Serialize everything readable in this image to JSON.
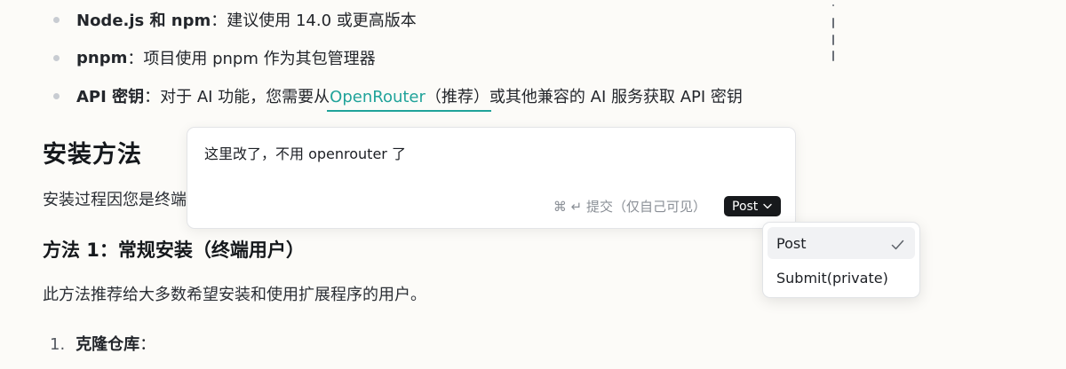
{
  "prerequisites": [
    {
      "term": "Node.js 和 npm",
      "sep": "：",
      "text": "建议使用 14.0 或更高版本"
    },
    {
      "term": "pnpm",
      "sep": "：",
      "text": "项目使用 pnpm 作为其包管理器"
    },
    {
      "term": "API 密钥",
      "sep": "：",
      "text_before": "对于 AI 功能，您需要从 ",
      "link": "OpenRouter",
      "text_after": "（推荐）或其他兼容的 AI 服务获取 API 密钥"
    }
  ],
  "install_section": {
    "title": "安装方法",
    "intro": "安装过程因您是终端"
  },
  "method1": {
    "title": "方法 1：常规安装（终端用户）",
    "description": "此方法推荐给大多数希望安装和使用扩展程序的用户。"
  },
  "steps": [
    {
      "number": "1.",
      "label": "克隆仓库",
      "sep": "："
    }
  ],
  "comment": {
    "text": "这里改了，不用 openrouter 了",
    "shortcut_icon": "command-enter-icon",
    "submit_hint": "⌘ ↵ 提交（仅自己可见）",
    "post_label": "Post"
  },
  "post_menu": {
    "options": [
      {
        "label": "Post",
        "selected": true
      },
      {
        "label": "Submit(private)",
        "selected": false
      }
    ]
  },
  "colors": {
    "accent": "#20a39a",
    "post_button_bg": "#17191c",
    "background": "#fcfbf8"
  }
}
